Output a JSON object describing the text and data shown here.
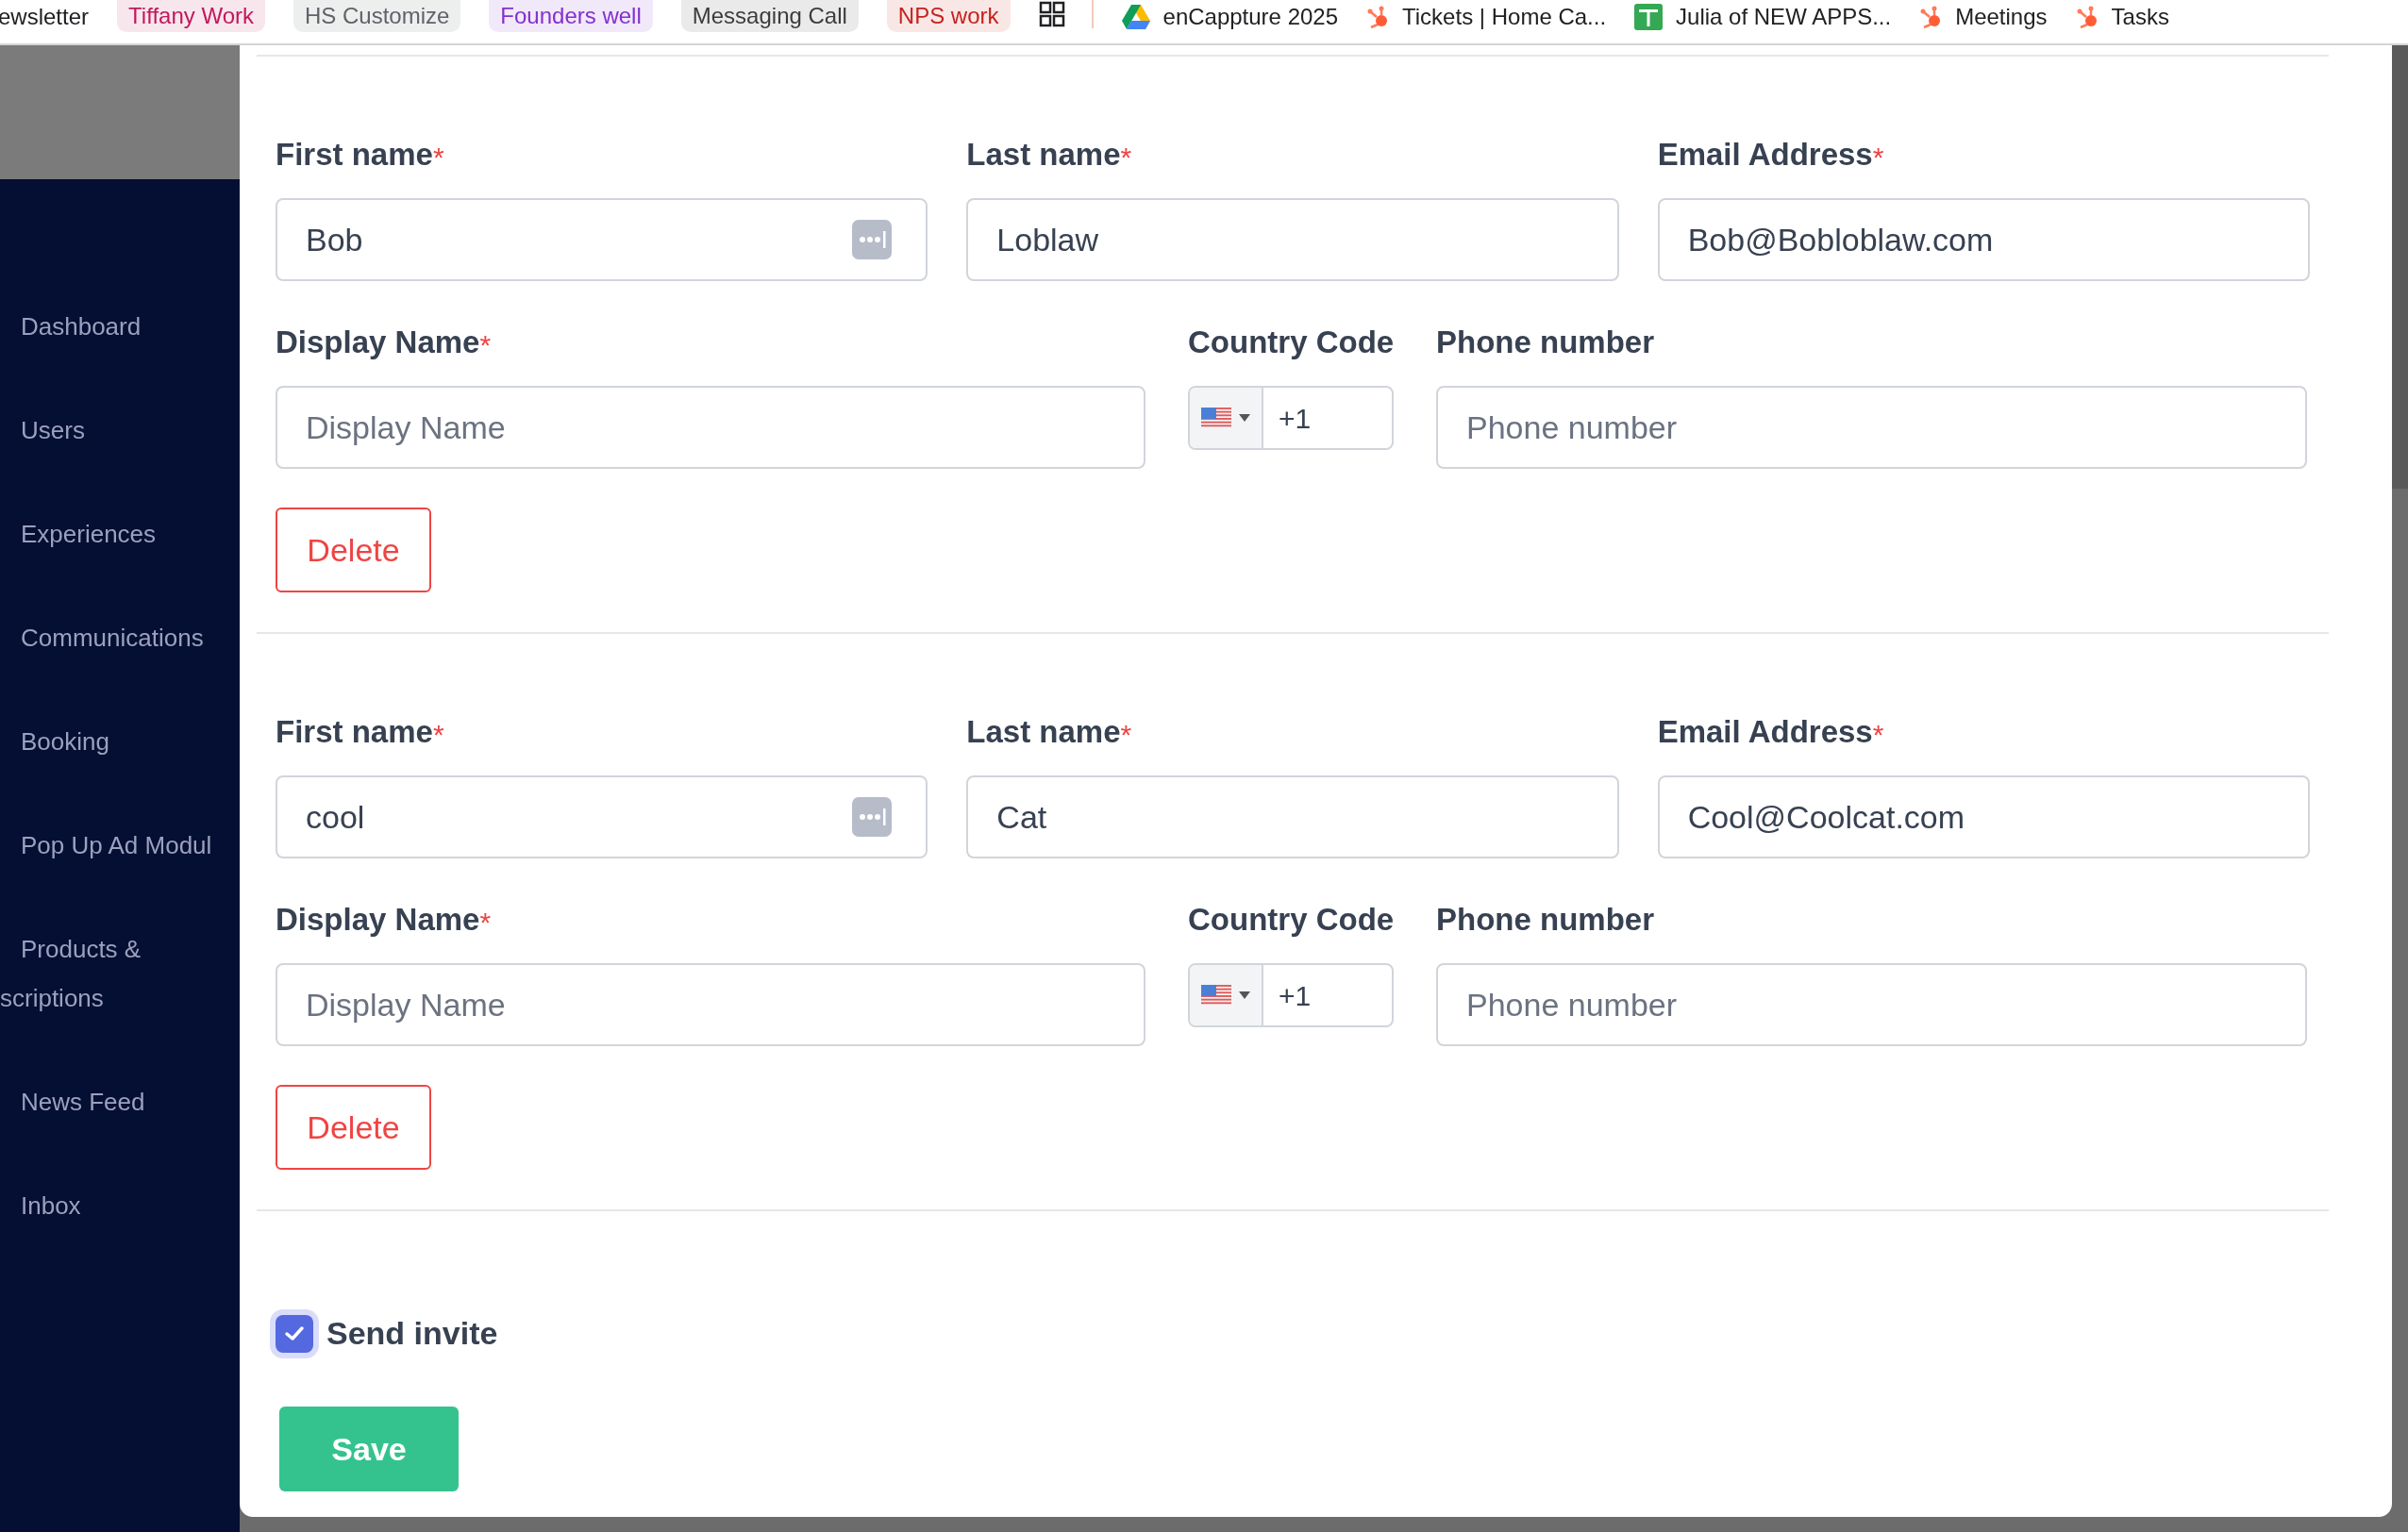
{
  "bookmarks": [
    {
      "kind": "plain",
      "label": "ewsletter"
    },
    {
      "kind": "pill",
      "label": "Tiffany Work",
      "color": "#c2185b"
    },
    {
      "kind": "pill",
      "label": "HS Customize",
      "color": "#5f6368"
    },
    {
      "kind": "pill",
      "label": "Founders well",
      "color": "#8430ce"
    },
    {
      "kind": "pill",
      "label": "Messaging Call",
      "color": "#3c3c3c"
    },
    {
      "kind": "pill",
      "label": "NPS work",
      "color": "#c5221f"
    },
    {
      "kind": "apps"
    },
    {
      "kind": "drive",
      "label": "enCappture 2025"
    },
    {
      "kind": "hubspot",
      "label": "Tickets | Home Ca..."
    },
    {
      "kind": "sheet",
      "label": "Julia of NEW APPS..."
    },
    {
      "kind": "hubspot",
      "label": "Meetings"
    },
    {
      "kind": "hubspot",
      "label": "Tasks"
    }
  ],
  "sidebar": {
    "items": [
      {
        "lines": [
          "Dashboard"
        ]
      },
      {
        "lines": [
          "Users"
        ]
      },
      {
        "lines": [
          "Experiences"
        ]
      },
      {
        "lines": [
          "Communications"
        ]
      },
      {
        "lines": [
          "Booking"
        ]
      },
      {
        "lines": [
          "Pop Up Ad Modul"
        ]
      },
      {
        "lines": [
          "Products &",
          "scriptions"
        ]
      },
      {
        "lines": [
          "News Feed"
        ]
      },
      {
        "lines": [
          "Inbox"
        ]
      }
    ]
  },
  "members": [
    {
      "fields": [
        {
          "kind": "text",
          "label": "First name",
          "required_mark": "*",
          "value": "Bob",
          "autofill": true
        },
        {
          "kind": "text",
          "label": "Last name",
          "required_mark": "*",
          "value": "Loblaw"
        },
        {
          "kind": "text",
          "label": "Email Address",
          "required_mark": "*",
          "value": "Bob@Bobloblaw.com"
        },
        {
          "kind": "text",
          "label": "Display Name",
          "required_mark": "*",
          "placeholder": "Display Name"
        },
        {
          "kind": "country",
          "label": "Country Code",
          "value": "+1"
        },
        {
          "kind": "text",
          "label": "Phone number",
          "placeholder": "Phone number"
        }
      ],
      "delete_label": "Delete"
    },
    {
      "fields": [
        {
          "kind": "text",
          "label": "First name",
          "required_mark": "*",
          "value": "cool",
          "autofill": true
        },
        {
          "kind": "text",
          "label": "Last name",
          "required_mark": "*",
          "value": "Cat"
        },
        {
          "kind": "text",
          "label": "Email Address",
          "required_mark": "*",
          "value": "Cool@Coolcat.com"
        },
        {
          "kind": "text",
          "label": "Display Name",
          "required_mark": "*",
          "placeholder": "Display Name"
        },
        {
          "kind": "country",
          "label": "Country Code",
          "value": "+1"
        },
        {
          "kind": "text",
          "label": "Phone number",
          "placeholder": "Phone number"
        }
      ],
      "delete_label": "Delete"
    }
  ],
  "invite": {
    "label": "Send invite",
    "checked": true
  },
  "save_button": "Save"
}
